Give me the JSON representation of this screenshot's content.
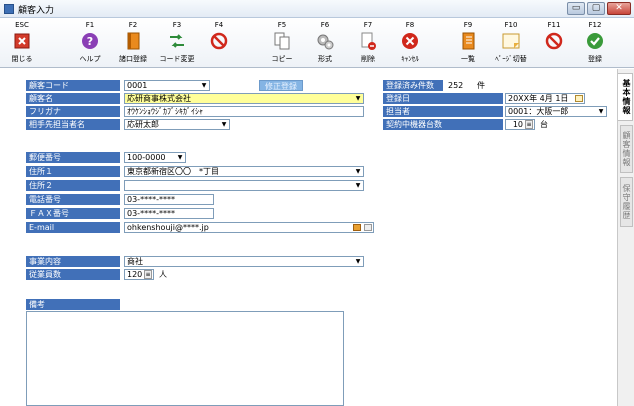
{
  "window": {
    "title": "顧客入力",
    "min_label": "▭",
    "max_label": "▢",
    "close_label": "✕"
  },
  "toolbar": [
    {
      "key": "ESC",
      "label": "閉じる",
      "icon": "close-x-icon"
    },
    {
      "key": "F1",
      "label": "ヘルプ",
      "icon": "help-icon"
    },
    {
      "key": "F2",
      "label": "諸口登録",
      "icon": "book-icon"
    },
    {
      "key": "F3",
      "label": "コード変更",
      "icon": "swap-icon"
    },
    {
      "key": "F4",
      "label": "",
      "icon": "prohibit-icon"
    },
    {
      "key": "F5",
      "label": "コピー",
      "icon": "copy-icon"
    },
    {
      "key": "F6",
      "label": "形式",
      "icon": "gears-icon"
    },
    {
      "key": "F7",
      "label": "削除",
      "icon": "delete-doc-icon"
    },
    {
      "key": "F8",
      "label": "ｷｬﾝｾﾙ",
      "icon": "cancel-icon"
    },
    {
      "key": "F9",
      "label": "一覧",
      "icon": "list-book-icon"
    },
    {
      "key": "F10",
      "label": "ﾍﾟｰｼﾞ切替",
      "icon": "page-switch-icon"
    },
    {
      "key": "F11",
      "label": "",
      "icon": "prohibit-icon"
    },
    {
      "key": "F12",
      "label": "登録",
      "icon": "check-icon"
    }
  ],
  "form": {
    "customer_code": {
      "label": "顧客コード",
      "value": "0001",
      "fix_button": "修正登録"
    },
    "registered_count": {
      "label": "登録済み件数",
      "value": "252",
      "unit": "件"
    },
    "customer_name": {
      "label": "顧客名",
      "value": "応研商事株式会社"
    },
    "registration_date": {
      "label": "登録日",
      "value": "20XX年 4月 1日"
    },
    "furigana": {
      "label": "フリガナ",
      "value": "ｵｳｹﾝｼｮｳｼﾞｶﾌﾞｼｷｶﾞｲｼｬ"
    },
    "staff": {
      "label": "担当者",
      "value": "0001：大阪一郎"
    },
    "contact_person": {
      "label": "相手先担当者名",
      "value": "応研太郎"
    },
    "devices": {
      "label": "契約中機器台数",
      "value": "10",
      "unit": "台"
    },
    "postal_code": {
      "label": "郵便番号",
      "value": "100-0000"
    },
    "address1": {
      "label": "住所１",
      "value": "東京都新宿区〇〇　*丁目"
    },
    "address2": {
      "label": "住所２",
      "value": ""
    },
    "phone": {
      "label": "電話番号",
      "value": "03-****-****"
    },
    "fax": {
      "label": "ＦＡＸ番号",
      "value": "03-****-****"
    },
    "email": {
      "label": "E-mail",
      "value": "ohkenshouji@****.jp"
    },
    "business": {
      "label": "事業内容",
      "value": "商社"
    },
    "employees": {
      "label": "従業員数",
      "value": "120",
      "unit": "人"
    },
    "notes": {
      "label": "備考",
      "value": ""
    }
  },
  "side_tabs": [
    "基本情報",
    "顧客情報",
    "保守履歴"
  ],
  "colors": {
    "label_bg": "#4170b8",
    "highlight": "#ffff99",
    "fix_button": "#84b4e4"
  }
}
